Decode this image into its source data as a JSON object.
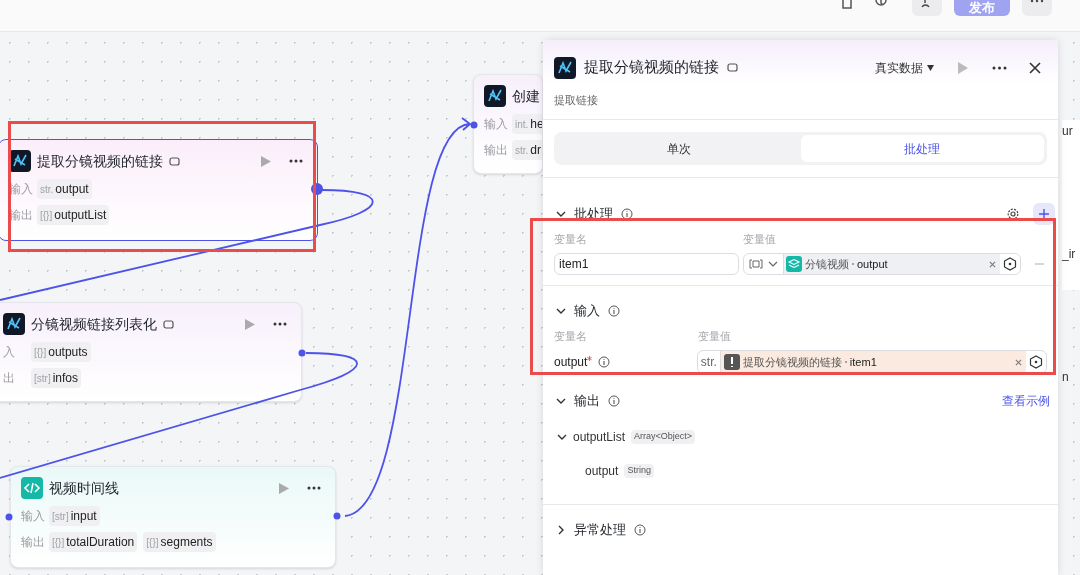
{
  "topbar": {
    "publish_button": "发布"
  },
  "nodes": [
    {
      "kind": "plugin",
      "title": "提取分镜视频的链接",
      "selected": true,
      "input_label": "输入",
      "output_label": "输出",
      "inputs": [
        {
          "type": "str.",
          "name": "output"
        }
      ],
      "outputs": [
        {
          "type": "[{}]",
          "name": "outputList"
        }
      ]
    },
    {
      "kind": "plugin",
      "title": "分镜视频链接列表化",
      "selected": false,
      "input_label": "入",
      "output_label": "出",
      "inputs": [
        {
          "type": "[{}]",
          "name": "outputs"
        }
      ],
      "outputs": [
        {
          "type": "[str]",
          "name": "infos"
        }
      ]
    },
    {
      "kind": "code",
      "title": "视频时间线",
      "selected": false,
      "input_label": "输入",
      "output_label": "输出",
      "inputs": [
        {
          "type": "[str]",
          "name": "input"
        }
      ],
      "outputs": [
        {
          "type": "[{}]",
          "name": "totalDuration"
        },
        {
          "type": "[{}]",
          "name": "segments"
        }
      ]
    },
    {
      "kind": "plugin",
      "title": "创建",
      "selected": false,
      "input_label": "输入",
      "output_label": "输出",
      "inputs": [
        {
          "type": "int.",
          "name": "he"
        }
      ],
      "outputs": [
        {
          "type": "str.",
          "name": "dr"
        }
      ]
    }
  ],
  "background_fragments": [
    "ur",
    "_ir",
    "n"
  ],
  "panel": {
    "title": "提取分镜视频的链接",
    "data_source": "真实数据",
    "subtitle": "提取链接",
    "tabs": [
      {
        "label": "单次",
        "selected": false
      },
      {
        "label": "批处理",
        "selected": true
      }
    ],
    "batch": {
      "title": "批处理",
      "expanded": true,
      "name_label": "变量名",
      "value_label": "变量值",
      "rows": [
        {
          "name": "item1",
          "source": "分镜视频",
          "field": "output"
        }
      ]
    },
    "input": {
      "title": "输入",
      "expanded": true,
      "name_label": "变量名",
      "value_label": "变量值",
      "params": [
        {
          "name": "output",
          "required": true,
          "type": "str.",
          "warning": true,
          "source": "提取分镜视频的链接",
          "field": "item1"
        }
      ]
    },
    "output": {
      "title": "输出",
      "expanded": true,
      "link": "查看示例",
      "tree": [
        {
          "name": "outputList",
          "type": "Array<Object>",
          "expanded": true,
          "children": [
            {
              "name": "output",
              "type": "String"
            }
          ]
        }
      ]
    },
    "exception": {
      "title": "异常处理",
      "expanded": false
    }
  }
}
